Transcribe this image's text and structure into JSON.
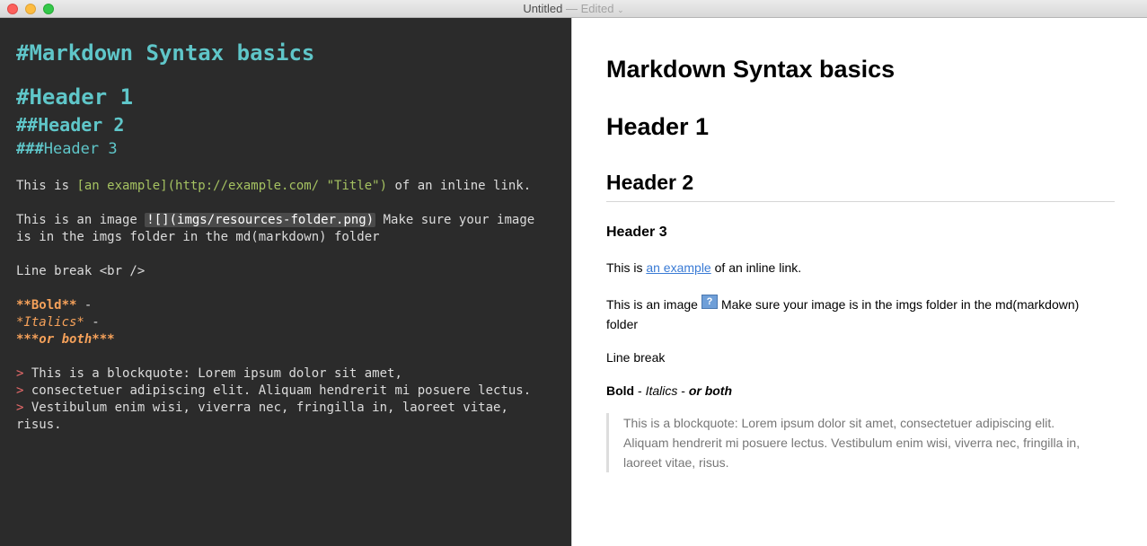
{
  "window": {
    "title": "Untitled",
    "separator": " — ",
    "status": "Edited",
    "chevron": "⌄"
  },
  "editor": {
    "title_hash": "#",
    "title_text": "Markdown Syntax basics",
    "h1": "#Header 1",
    "h2": "##Header 2",
    "h3_hash": "###",
    "h3_text": "Header 3",
    "link_line": {
      "prefix": "This is ",
      "link": "[an example](http://example.com/ \"Title\")",
      "suffix": " of an inline link."
    },
    "image_line": {
      "prefix": "This is an image ",
      "ref": "![](imgs/resources-folder.png)",
      "suffix": " Make sure your image",
      "line2": "is in the imgs folder in the md(markdown) folder"
    },
    "line_break": "Line break <br />",
    "bold_md": "**Bold**",
    "italics_md": "*Italics*",
    "both_md": "***or both***",
    "dash": " -",
    "quote_marker": ">",
    "quote_lines": [
      " This is a blockquote: Lorem ipsum dolor sit amet,",
      " consectetuer adipiscing elit. Aliquam hendrerit mi posuere lectus.",
      " Vestibulum enim wisi, viverra nec, fringilla in, laoreet vitae,"
    ],
    "quote_tail": "risus."
  },
  "preview": {
    "title": "Markdown Syntax basics",
    "h1": "Header 1",
    "h2": "Header 2",
    "h3": "Header 3",
    "link_prefix": "This is ",
    "link_text": "an example",
    "link_suffix": " of an inline link.",
    "image_prefix": "This is an image",
    "image_icon": "?",
    "image_suffix": "Make sure your image is in the imgs folder in the md(markdown) folder",
    "line_break": "Line break",
    "bold": "Bold",
    "sep": " - ",
    "italics": "Italics",
    "both": "or both",
    "blockquote": "This is a blockquote: Lorem ipsum dolor sit amet, consectetuer adipiscing elit. Aliquam hendrerit mi posuere lectus. Vestibulum enim wisi, viverra nec, fringilla in, laoreet vitae, risus."
  },
  "colors": {
    "editor_bg": "#2b2b2b",
    "heading": "#5fc6c9",
    "link": "#a5c261",
    "emphasis": "#f5a15a",
    "quote_marker": "#e86a6a"
  }
}
